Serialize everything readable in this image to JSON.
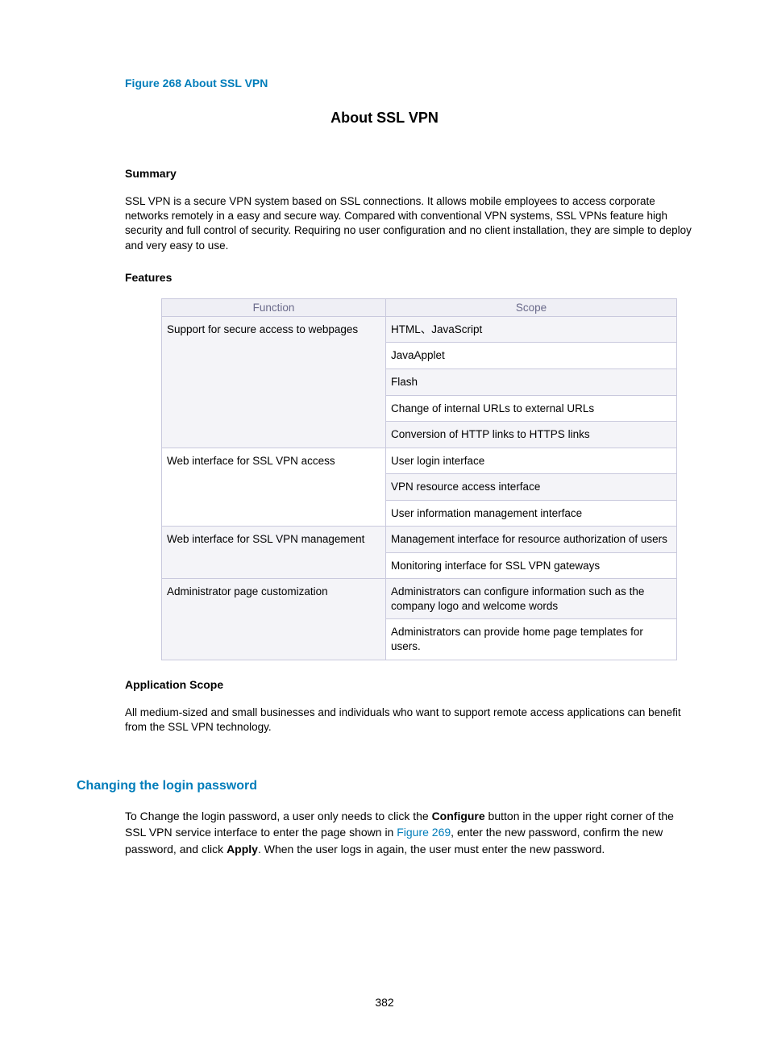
{
  "figure_caption": "Figure 268 About SSL VPN",
  "main_title": "About SSL VPN",
  "summary_heading": "Summary",
  "summary_text": "SSL VPN is a secure VPN system based on SSL connections. It allows mobile employees to access corporate networks remotely in a easy and secure way. Compared with conventional VPN systems, SSL VPNs feature high security and full control of security. Requiring no user configuration and no client installation, they are simple to deploy and very easy to use.",
  "features_heading": "Features",
  "table": {
    "headers": {
      "function": "Function",
      "scope": "Scope"
    },
    "rows": [
      {
        "function": "Support for secure access to webpages",
        "scope": "HTML、JavaScript",
        "rowspan": 5,
        "show_func": true
      },
      {
        "scope": "JavaApplet",
        "show_func": false
      },
      {
        "scope": "Flash",
        "show_func": false
      },
      {
        "scope": "Change of internal URLs to external URLs",
        "show_func": false
      },
      {
        "scope": "Conversion of HTTP links to HTTPS links",
        "show_func": false
      },
      {
        "function": "Web interface for SSL VPN access",
        "scope": "User login interface",
        "rowspan": 3,
        "show_func": true
      },
      {
        "scope": "VPN resource access interface",
        "show_func": false
      },
      {
        "scope": "User information management interface",
        "show_func": false
      },
      {
        "function": "Web interface for SSL VPN management",
        "scope": "Management interface for resource authorization of users",
        "rowspan": 2,
        "show_func": true
      },
      {
        "scope": "Monitoring interface for SSL VPN gateways",
        "show_func": false
      },
      {
        "function": "Administrator page customization",
        "scope": "Administrators can configure information such as the company logo and welcome words",
        "rowspan": 2,
        "show_func": true
      },
      {
        "scope": "Administrators can provide home page templates for users.",
        "show_func": false
      }
    ]
  },
  "app_scope_heading": "Application Scope",
  "app_scope_text": "All medium-sized and small businesses and individuals who want to support remote access applications can benefit from the SSL VPN technology.",
  "changing_heading": "Changing the login password",
  "para": {
    "part1": "To Change the login password, a user only needs to click the ",
    "bold1": "Configure",
    "part2": " button in the upper right corner of the SSL VPN service interface to enter the page shown in ",
    "link": "Figure 269",
    "part3": ", enter the new password, confirm the new password, and click ",
    "bold2": "Apply",
    "part4": ". When the user logs in again, the user must enter the new password."
  },
  "page_number": "382"
}
